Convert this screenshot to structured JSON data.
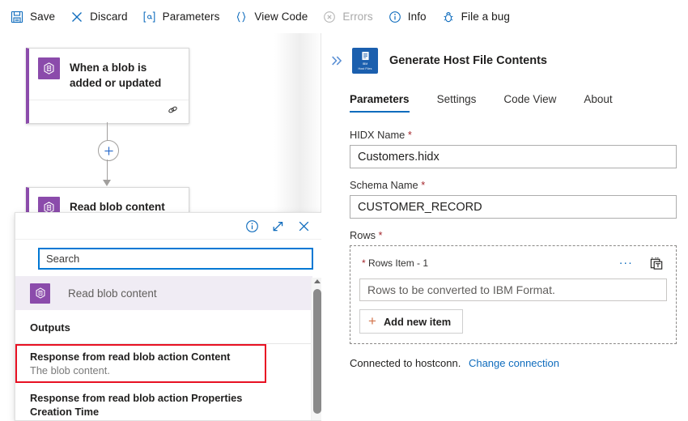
{
  "toolbar": {
    "items": [
      {
        "label": "Save",
        "icon": "save-icon",
        "disabled": false
      },
      {
        "label": "Discard",
        "icon": "close-x-icon",
        "disabled": false
      },
      {
        "label": "Parameters",
        "icon": "at-bracket-icon",
        "disabled": false
      },
      {
        "label": "View Code",
        "icon": "curly-braces-icon",
        "disabled": false
      },
      {
        "label": "Errors",
        "icon": "error-circle-icon",
        "disabled": true
      },
      {
        "label": "Info",
        "icon": "info-circle-icon",
        "disabled": false
      },
      {
        "label": "File a bug",
        "icon": "bug-icon",
        "disabled": false
      }
    ]
  },
  "canvas": {
    "trigger_node": {
      "title": "When a blob is added or updated",
      "icon": "azure-blob-icon",
      "footer_icon": "link-connection-icon",
      "accent_color": "#8b4bab"
    },
    "add_step_button": {
      "icon": "plus-icon"
    },
    "action_node": {
      "title": "Read blob content",
      "icon": "azure-blob-icon",
      "accent_color": "#8b4bab"
    }
  },
  "dynamic_content_popup": {
    "header_icons": [
      {
        "name": "info-icon",
        "glyph": "info"
      },
      {
        "name": "expand-icon",
        "glyph": "expand"
      },
      {
        "name": "close-icon",
        "glyph": "close"
      }
    ],
    "search": {
      "placeholder": "Search",
      "value": ""
    },
    "group": {
      "label": "Read blob content",
      "icon": "azure-blob-icon"
    },
    "section_title": "Outputs",
    "tokens": [
      {
        "name": "Response from read blob action Content",
        "description": "The blob content.",
        "highlighted": true
      },
      {
        "name": "Response from read blob action Properties Creation Time",
        "description": "",
        "highlighted": false
      }
    ],
    "highlight_color": "#e81123",
    "scrollbar": {
      "visible": true
    }
  },
  "properties_pane": {
    "collapse_icon": "double-chevron-right-icon",
    "connector_icon": {
      "name": "ibm-host-files-icon",
      "line1": "IBM",
      "line2": "Host Files",
      "color": "#1b5fae"
    },
    "title": "Generate Host File Contents",
    "tabs": [
      {
        "label": "Parameters",
        "active": true
      },
      {
        "label": "Settings",
        "active": false
      },
      {
        "label": "Code View",
        "active": false
      },
      {
        "label": "About",
        "active": false
      }
    ],
    "fields": [
      {
        "label": "HIDX Name",
        "required": true,
        "value": "Customers.hidx",
        "placeholder": ""
      },
      {
        "label": "Schema Name",
        "required": true,
        "value": "CUSTOMER_RECORD",
        "placeholder": ""
      }
    ],
    "rows_section": {
      "label": "Rows",
      "required": true,
      "item_label": "Rows Item - 1",
      "item_required": true,
      "ellipsis_label": "...",
      "dynamic_content_icon": "dynamic-content-token-icon",
      "input_placeholder": "Rows to be converted to IBM Format.",
      "input_value": "",
      "add_button_label": "Add new item",
      "add_button_icon": "plus-icon"
    },
    "connection": {
      "status_text": "Connected to hostconn.",
      "change_link": "Change connection"
    }
  }
}
